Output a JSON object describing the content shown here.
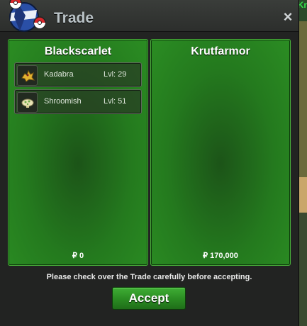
{
  "window": {
    "title": "Trade",
    "close_label": "×"
  },
  "world": {
    "label": "Kr"
  },
  "left_panel": {
    "name": "Blackscarlet",
    "items": [
      {
        "name": "Kadabra",
        "level": "Lvl: 29",
        "icon": "kadabra-icon"
      },
      {
        "name": "Shroomish",
        "level": "Lvl: 51",
        "icon": "shroomish-icon"
      }
    ],
    "money": "₽ 0"
  },
  "right_panel": {
    "name": "Krutfarmor",
    "money": "₽ 170,000"
  },
  "footer": {
    "notice": "Please check over the Trade carefully before accepting.",
    "accept_label": "Accept"
  },
  "colors": {
    "panel_green": "#247a1e",
    "panel_border": "#49b43a",
    "accept_green": "#2a8a22",
    "title_text": "#b9c2c6"
  }
}
